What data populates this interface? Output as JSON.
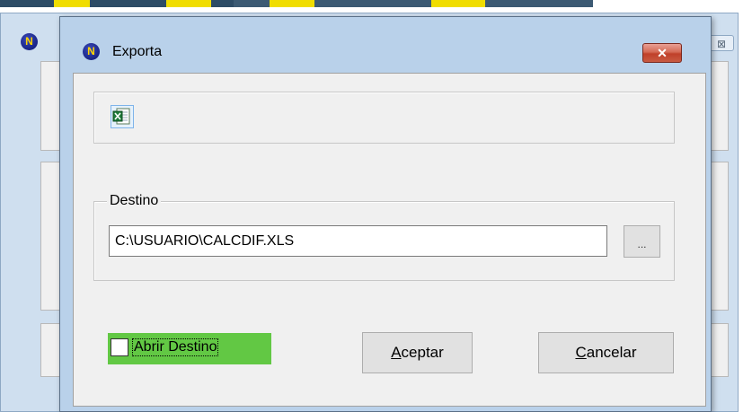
{
  "background_window": {
    "logo_letter": "N",
    "close_glyph": "⊠"
  },
  "dialog": {
    "title": "Exporta",
    "logo_letter": "N",
    "close_glyph": "✕",
    "export_icon": "excel-icon",
    "destination": {
      "legend": "Destino",
      "path_value": "C:\\USUARIO\\CALCDIF.XLS",
      "browse_label": "..."
    },
    "open_destination": {
      "label": "Abrir Destino",
      "checked": false
    },
    "accept": {
      "mnemonic": "A",
      "rest": "ceptar"
    },
    "cancel": {
      "mnemonic": "C",
      "rest": "ancelar"
    }
  },
  "colors": {
    "dialog_frame": "#b9d1ea",
    "client_bg": "#f0f0f0",
    "close_red": "#c0402a",
    "highlight_green": "#62c844"
  }
}
